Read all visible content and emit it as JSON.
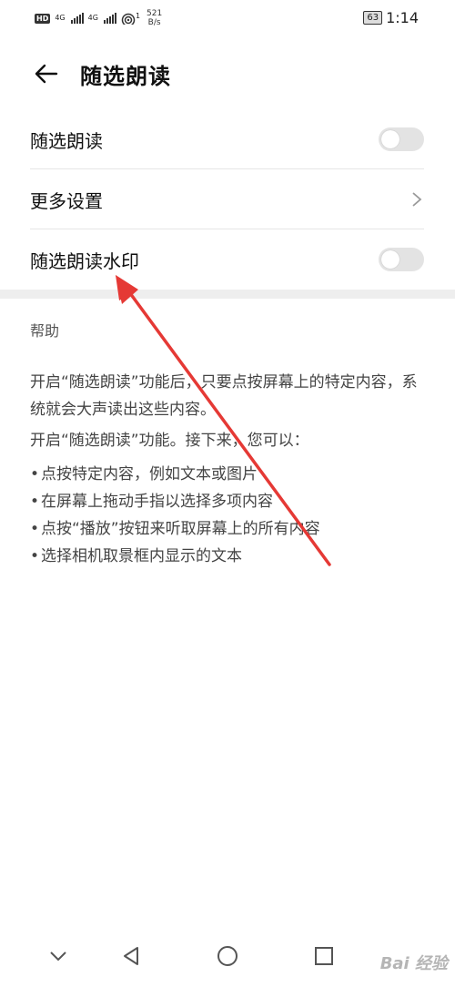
{
  "status_bar": {
    "hd": "HD",
    "net1": "4G",
    "net2": "4G",
    "wifi_badge": "1",
    "speed_value": "521",
    "speed_unit": "B/s",
    "battery": "63",
    "time": "1:14"
  },
  "header": {
    "title": "随选朗读"
  },
  "settings": {
    "rows": [
      {
        "label": "随选朗读",
        "type": "toggle",
        "on": false
      },
      {
        "label": "更多设置",
        "type": "chevron"
      },
      {
        "label": "随选朗读水印",
        "type": "toggle",
        "on": false
      }
    ]
  },
  "help": {
    "title": "帮助",
    "intro": "开启“随选朗读”功能后，只要点按屏幕上的特定内容，系统就会大声读出这些内容。",
    "next": "开启“随选朗读”功能。接下来，您可以：",
    "bullets": [
      "点按特定内容，例如文本或图片",
      "在屏幕上拖动手指以选择多项内容",
      "点按“播放”按钮来听取屏幕上的所有内容",
      "选择相机取景框内显示的文本"
    ]
  },
  "watermark": "Bai 经验",
  "colors": {
    "arrow": "#e53935",
    "toggle_off": "#e3e3e3"
  }
}
